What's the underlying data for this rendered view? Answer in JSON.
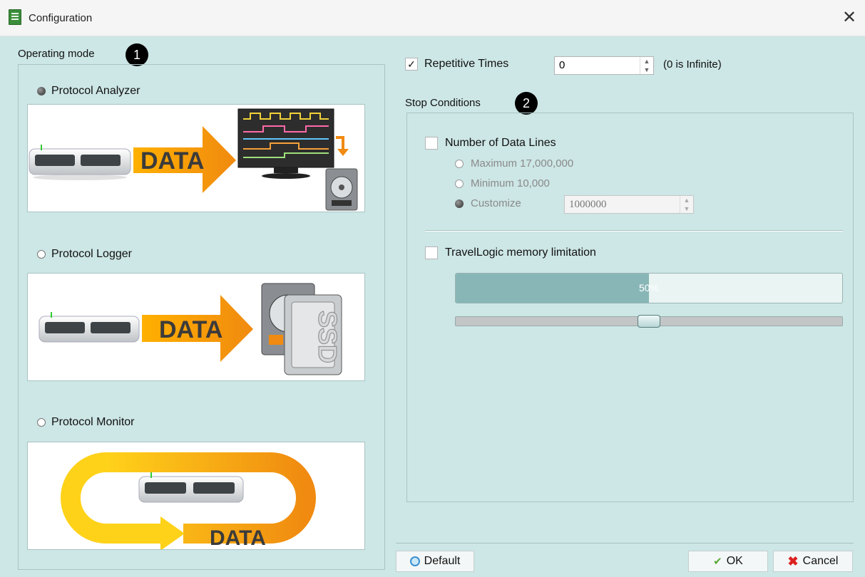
{
  "window": {
    "title": "Configuration",
    "close_glyph": "✕"
  },
  "operating_mode": {
    "label": "Operating mode",
    "badge": "1",
    "modes": [
      {
        "label": "Protocol Analyzer",
        "selected": true,
        "image_text": "DATA",
        "image_icons": [
          "device-icon",
          "arrow-icon",
          "monitor-icon",
          "hard-drive-icon"
        ]
      },
      {
        "label": "Protocol Logger",
        "selected": false,
        "image_text": "DATA",
        "ssd_text": "SSD",
        "image_icons": [
          "device-icon",
          "arrow-icon",
          "hard-drive-icon",
          "ssd-icon"
        ]
      },
      {
        "label": "Protocol Monitor",
        "selected": false,
        "image_text": "DATA",
        "image_icons": [
          "device-icon",
          "loop-arrow-icon"
        ]
      }
    ]
  },
  "repetitive": {
    "checked": true,
    "check_glyph": "✓",
    "label": "Repetitive Times",
    "value": "0",
    "hint": "(0 is Infinite)"
  },
  "stop_conditions": {
    "label": "Stop Conditions",
    "badge": "2",
    "number_of_data_lines": {
      "checked": false,
      "label": "Number of Data Lines",
      "options": [
        {
          "label": "Maximum 17,000,000",
          "selected": false
        },
        {
          "label": "Minimum 10,000",
          "selected": false
        },
        {
          "label": "Customize",
          "selected": true
        }
      ],
      "customize_value": "1000000"
    },
    "memory_limitation": {
      "checked": false,
      "label": "TravelLogic memory limitation",
      "progress_percent": 50,
      "progress_text": "50%",
      "slider_level": 0.5
    }
  },
  "buttons": {
    "default_label": "Default",
    "ok_label": "OK",
    "cancel_label": "Cancel",
    "ok_glyph": "✔",
    "cancel_glyph": "✖"
  },
  "colors": {
    "background": "#cde6e6",
    "data_orange": "#f29a12",
    "progress_fill": "#88b6b6"
  }
}
